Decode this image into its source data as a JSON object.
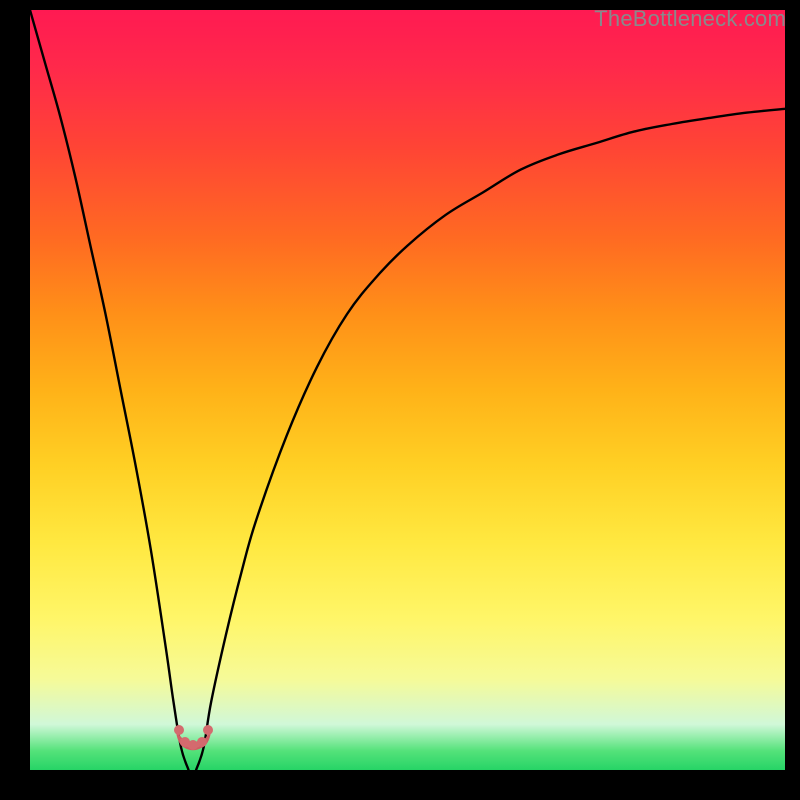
{
  "watermark": {
    "text": "TheBottleneck.com"
  },
  "chart_data": {
    "type": "line",
    "title": "",
    "xlabel": "",
    "ylabel": "",
    "xlim": [
      0,
      100
    ],
    "ylim": [
      0,
      100
    ],
    "grid": false,
    "legend": false,
    "x": [
      0,
      2,
      4,
      6,
      8,
      10,
      12,
      14,
      16,
      18,
      19,
      20,
      21,
      22,
      23,
      24,
      26,
      28,
      30,
      34,
      38,
      42,
      46,
      50,
      55,
      60,
      65,
      70,
      75,
      80,
      85,
      90,
      95,
      100
    ],
    "values": [
      100,
      93,
      86,
      78,
      69,
      60,
      50,
      40,
      29,
      16,
      9,
      3,
      0,
      0,
      3,
      9,
      18,
      26,
      33,
      44,
      53,
      60,
      65,
      69,
      73,
      76,
      79,
      81,
      82.5,
      84,
      85,
      85.8,
      86.5,
      87
    ],
    "background_gradient_colors": [
      "#ff1a52",
      "#ff6a22",
      "#ffd024",
      "#fff668",
      "#26d466"
    ],
    "minimum_marker": {
      "x_range": [
        20,
        23
      ],
      "color": "#d46a6e"
    }
  }
}
